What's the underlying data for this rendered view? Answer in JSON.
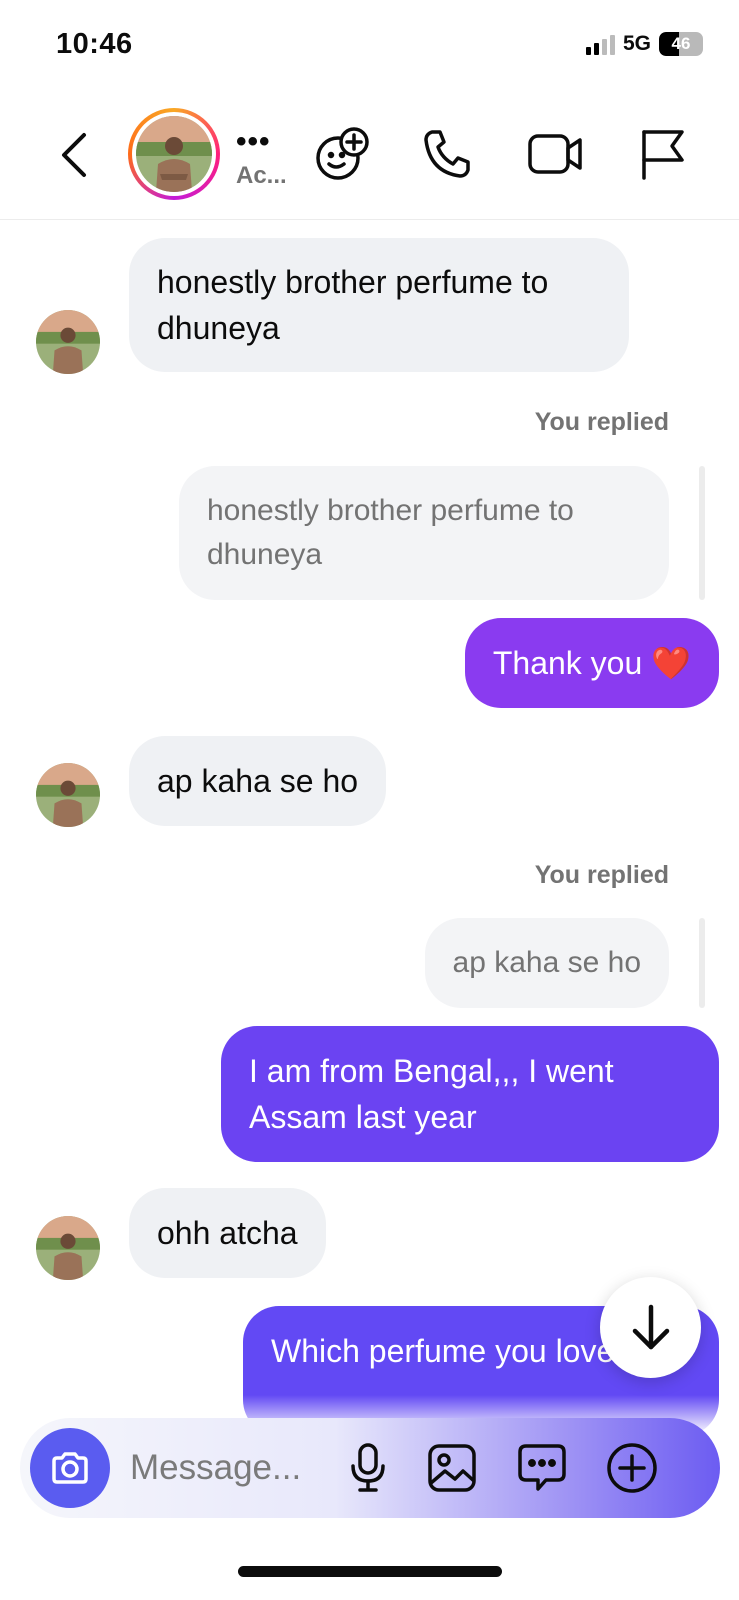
{
  "status_bar": {
    "time": "10:46",
    "network": "5G",
    "battery": "46",
    "battery_level": 0.46
  },
  "header": {
    "contact_name": "•••",
    "contact_status": "Ac..."
  },
  "messages": [
    {
      "dir": "in",
      "text": "honestly brother perfume to dhuneya"
    },
    {
      "dir": "reply",
      "label": "You replied",
      "quote": "honestly brother perfume to dhuneya"
    },
    {
      "dir": "out",
      "text": "Thank you ❤️"
    },
    {
      "dir": "in",
      "text": "ap kaha se ho"
    },
    {
      "dir": "reply",
      "label": "You replied",
      "quote": "ap kaha se ho"
    },
    {
      "dir": "out",
      "text": "I am from Bengal,,, I went Assam last year"
    },
    {
      "dir": "in",
      "text": "ohh atcha"
    },
    {
      "dir": "out",
      "text": "Which perfume you love"
    }
  ],
  "composer": {
    "placeholder": "Message..."
  },
  "icons": {
    "back": "chevron-left-icon",
    "sticker": "sticker-add-icon",
    "call": "phone-icon",
    "video": "video-camera-icon",
    "report": "flag-icon",
    "scroll": "arrow-down-icon",
    "camera": "camera-icon",
    "mic": "microphone-icon",
    "gallery": "image-icon",
    "chat": "chat-bubble-icon",
    "add": "plus-circle-icon"
  },
  "colors": {
    "outgoing_1": "#8a3bf0",
    "outgoing_2": "#6b43f2",
    "incoming": "#eff1f4",
    "accent": "#5a5cf0"
  }
}
